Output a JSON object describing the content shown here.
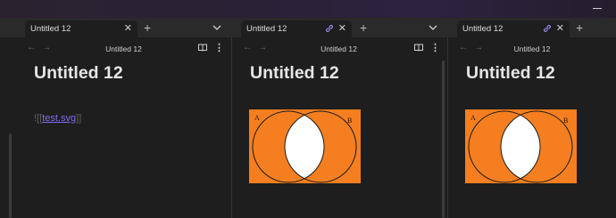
{
  "app": {
    "accent": "#7f6df2",
    "background": "#1e1e1e",
    "tabstrip_bg": "#2a2a2a"
  },
  "panes": [
    {
      "tab_label": "Untitled 12",
      "nav_title": "Untitled 12",
      "doc_title": "Untitled 12",
      "embed_open": "![[",
      "embed_target": "test.svg",
      "embed_close": "]]",
      "icons": [
        "back-arrow-icon",
        "forward-arrow-icon",
        "reading-view-icon",
        "more-options-icon",
        "close-icon",
        "new-tab-icon",
        "tab-list-chevron-icon"
      ]
    },
    {
      "tab_label": "Untitled 12",
      "nav_title": "Untitled 12",
      "doc_title": "Untitled 12",
      "image": {
        "left_label": "A",
        "right_label": "B",
        "fill": "#f57f20",
        "intersection_fill": "#ffffff"
      },
      "icons": [
        "linked-icon",
        "close-icon",
        "new-tab-icon",
        "tab-list-chevron-icon",
        "reading-view-icon",
        "more-options-icon"
      ]
    },
    {
      "tab_label": "Untitled 12",
      "nav_title": "Untitled 12",
      "doc_title": "Untitled 12",
      "image": {
        "left_label": "A",
        "right_label": "B",
        "fill": "#f57f20",
        "intersection_fill": "#ffffff"
      },
      "icons": [
        "linked-icon",
        "close-icon",
        "new-tab-icon"
      ]
    }
  ]
}
